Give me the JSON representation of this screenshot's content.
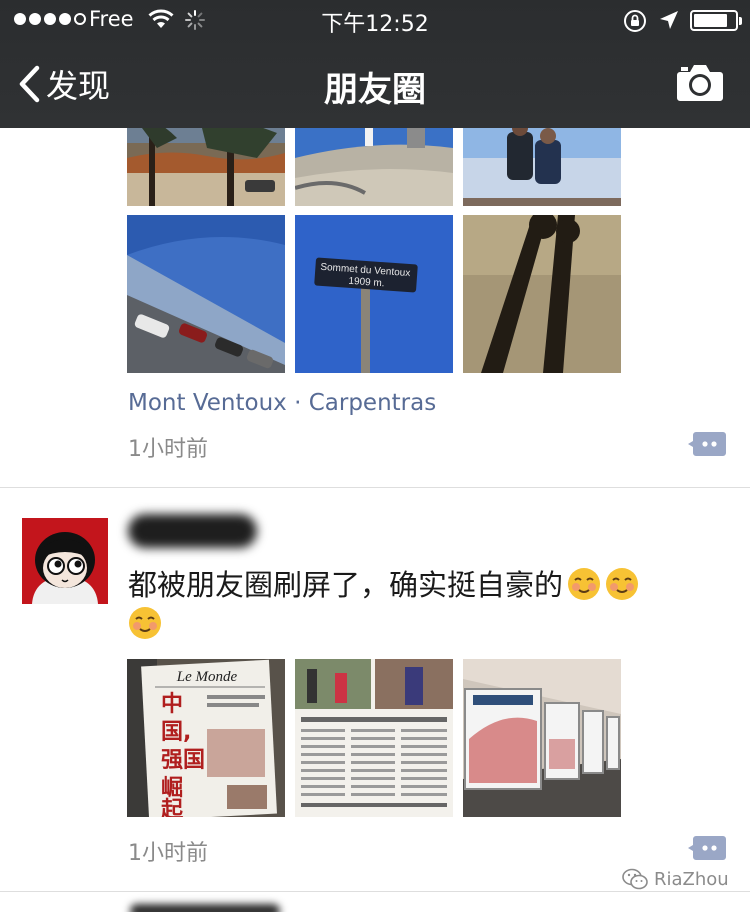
{
  "status_bar": {
    "carrier": "Free",
    "time": "下午12:52"
  },
  "nav": {
    "back_label": "发现",
    "title": "朋友圈",
    "icons": {
      "back": "chevron-left-icon",
      "camera": "camera-icon"
    }
  },
  "colors": {
    "bar_background": "#2e3032",
    "link_blue": "#576b95",
    "time_gray": "#8a8a8a",
    "comment_button": "#9aa7c6"
  },
  "posts": [
    {
      "location": "Mont Ventoux · Carpentras",
      "time": "1小时前",
      "images": [
        {
          "subject": "forest-trees-photo"
        },
        {
          "subject": "summit-station-photo"
        },
        {
          "subject": "two-people-summit-photo"
        },
        {
          "subject": "tilted-mountain-view-photo"
        },
        {
          "subject": "summit-sign-photo",
          "sign_text": "Sommet du Ventoux 1909 m"
        },
        {
          "subject": "shadows-on-grass-photo"
        }
      ]
    },
    {
      "text": "都被朋友圈刷屏了，确实挺自豪的",
      "emoji_count": 3,
      "time": "1小时前",
      "images": [
        {
          "subject": "newspaper-le-monde-photo",
          "masthead": "Le Monde",
          "headline": "中国，强国崛起"
        },
        {
          "subject": "newspaper-spread-photo"
        },
        {
          "subject": "subway-ads-photo"
        }
      ]
    }
  ],
  "watermark": "RiaZhou"
}
